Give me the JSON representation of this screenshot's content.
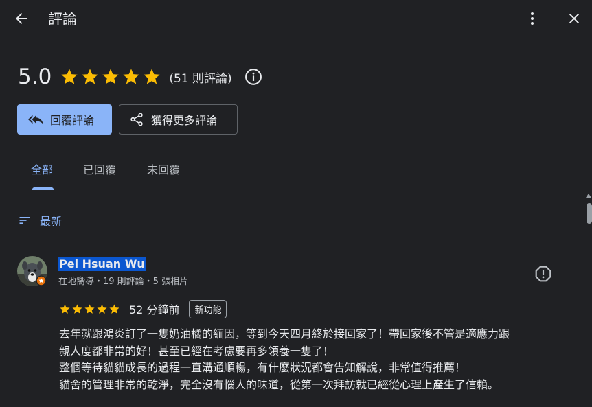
{
  "header": {
    "title": "評論",
    "back_icon": "arrow-left-icon",
    "more_icon": "more-vertical-icon",
    "close_icon": "close-icon"
  },
  "summary": {
    "score": "5.0",
    "stars": 5,
    "count_label": "(51 則評論)",
    "info_icon": "info-icon"
  },
  "actions": {
    "reply_label": "回覆評論",
    "more_reviews_label": "獲得更多評論"
  },
  "tabs": [
    {
      "label": "全部",
      "active": true
    },
    {
      "label": "已回覆",
      "active": false
    },
    {
      "label": "未回覆",
      "active": false
    }
  ],
  "sort": {
    "label": "最新",
    "icon": "sort-icon"
  },
  "review": {
    "author": "Pei Hsuan Wu",
    "meta": "在地嚮導・19 則評論・5 張相片",
    "stars": 5,
    "time": "52 分鐘前",
    "badge": "新功能",
    "lines": [
      "去年就跟鴻炎訂了一隻奶油橘的緬因，等到今天四月終於接回家了！帶回家後不管是適應力跟",
      "親人度都非常的好！甚至已經在考慮要再多領養一隻了！",
      "整個等待貓貓成長的過程一直溝通順暢，有什麼狀況都會告知解說，非常值得推薦！",
      "貓舍的管理非常的乾淨，完全沒有惱人的味道，從第一次拜訪就已經從心理上產生了信賴。"
    ]
  },
  "colors": {
    "background": "#202124",
    "accent": "#8ab4f8",
    "star": "#fbbc04",
    "selection": "#0b57d0"
  }
}
